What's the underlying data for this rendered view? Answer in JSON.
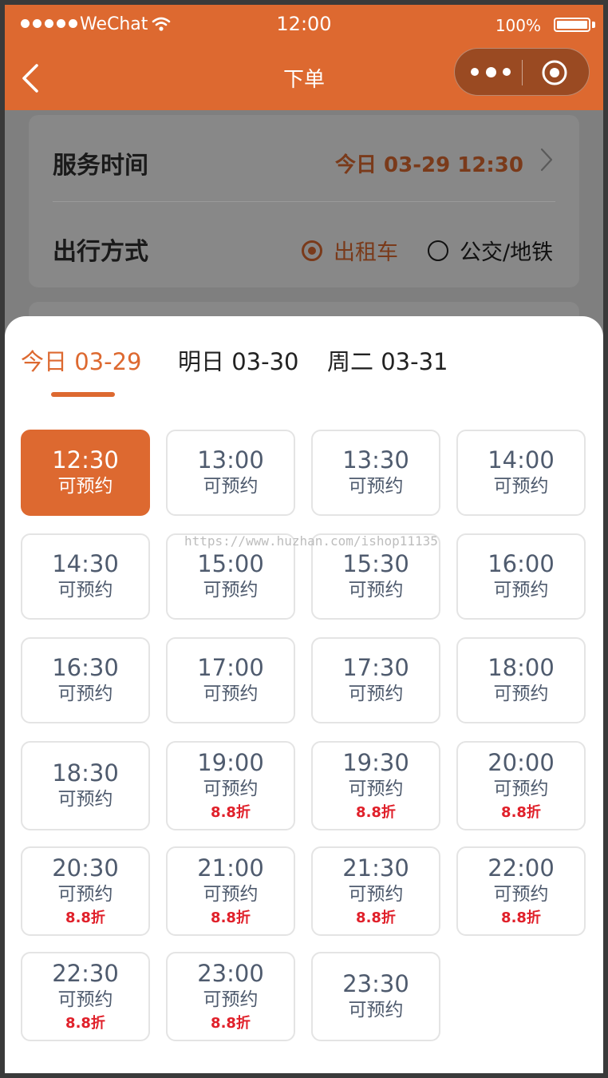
{
  "status_bar": {
    "carrier": "WeChat",
    "time": "12:00",
    "battery": "100%"
  },
  "nav": {
    "title": "下单"
  },
  "form": {
    "service_time_label": "服务时间",
    "service_time_value": "今日 03-29 12:30",
    "travel_mode_label": "出行方式",
    "travel_modes": [
      {
        "label": "出租车",
        "selected": true
      },
      {
        "label": "公交/地铁",
        "selected": false
      }
    ]
  },
  "tabs": [
    {
      "label": "今日 03-29",
      "active": true
    },
    {
      "label": "明日 03-30",
      "active": false
    },
    {
      "label": "周二 03-31",
      "active": false
    }
  ],
  "watermark": "https://www.huzhan.com/ishop11135",
  "slots": [
    {
      "time": "12:30",
      "status": "可预约",
      "discount": "",
      "selected": true
    },
    {
      "time": "13:00",
      "status": "可预约",
      "discount": ""
    },
    {
      "time": "13:30",
      "status": "可预约",
      "discount": ""
    },
    {
      "time": "14:00",
      "status": "可预约",
      "discount": ""
    },
    {
      "time": "14:30",
      "status": "可预约",
      "discount": ""
    },
    {
      "time": "15:00",
      "status": "可预约",
      "discount": ""
    },
    {
      "time": "15:30",
      "status": "可预约",
      "discount": ""
    },
    {
      "time": "16:00",
      "status": "可预约",
      "discount": ""
    },
    {
      "time": "16:30",
      "status": "可预约",
      "discount": ""
    },
    {
      "time": "17:00",
      "status": "可预约",
      "discount": ""
    },
    {
      "time": "17:30",
      "status": "可预约",
      "discount": ""
    },
    {
      "time": "18:00",
      "status": "可预约",
      "discount": ""
    },
    {
      "time": "18:30",
      "status": "可预约",
      "discount": ""
    },
    {
      "time": "19:00",
      "status": "可预约",
      "discount": "8.8折"
    },
    {
      "time": "19:30",
      "status": "可预约",
      "discount": "8.8折"
    },
    {
      "time": "20:00",
      "status": "可预约",
      "discount": "8.8折"
    },
    {
      "time": "20:30",
      "status": "可预约",
      "discount": "8.8折"
    },
    {
      "time": "21:00",
      "status": "可预约",
      "discount": "8.8折"
    },
    {
      "time": "21:30",
      "status": "可预约",
      "discount": "8.8折"
    },
    {
      "time": "22:00",
      "status": "可预约",
      "discount": "8.8折"
    },
    {
      "time": "22:30",
      "status": "可预约",
      "discount": "8.8折"
    },
    {
      "time": "23:00",
      "status": "可预约",
      "discount": "8.8折"
    },
    {
      "time": "23:30",
      "status": "可预约",
      "discount": ""
    }
  ],
  "colors": {
    "accent": "#dd6930",
    "discount": "#e0202a",
    "slot_text": "#4f5b6e"
  },
  "icons": [
    "signal-icon",
    "wifi-icon",
    "battery-icon",
    "back-arrow-icon",
    "more-icon",
    "close-target-icon",
    "chevron-right-icon",
    "radio-icon"
  ]
}
